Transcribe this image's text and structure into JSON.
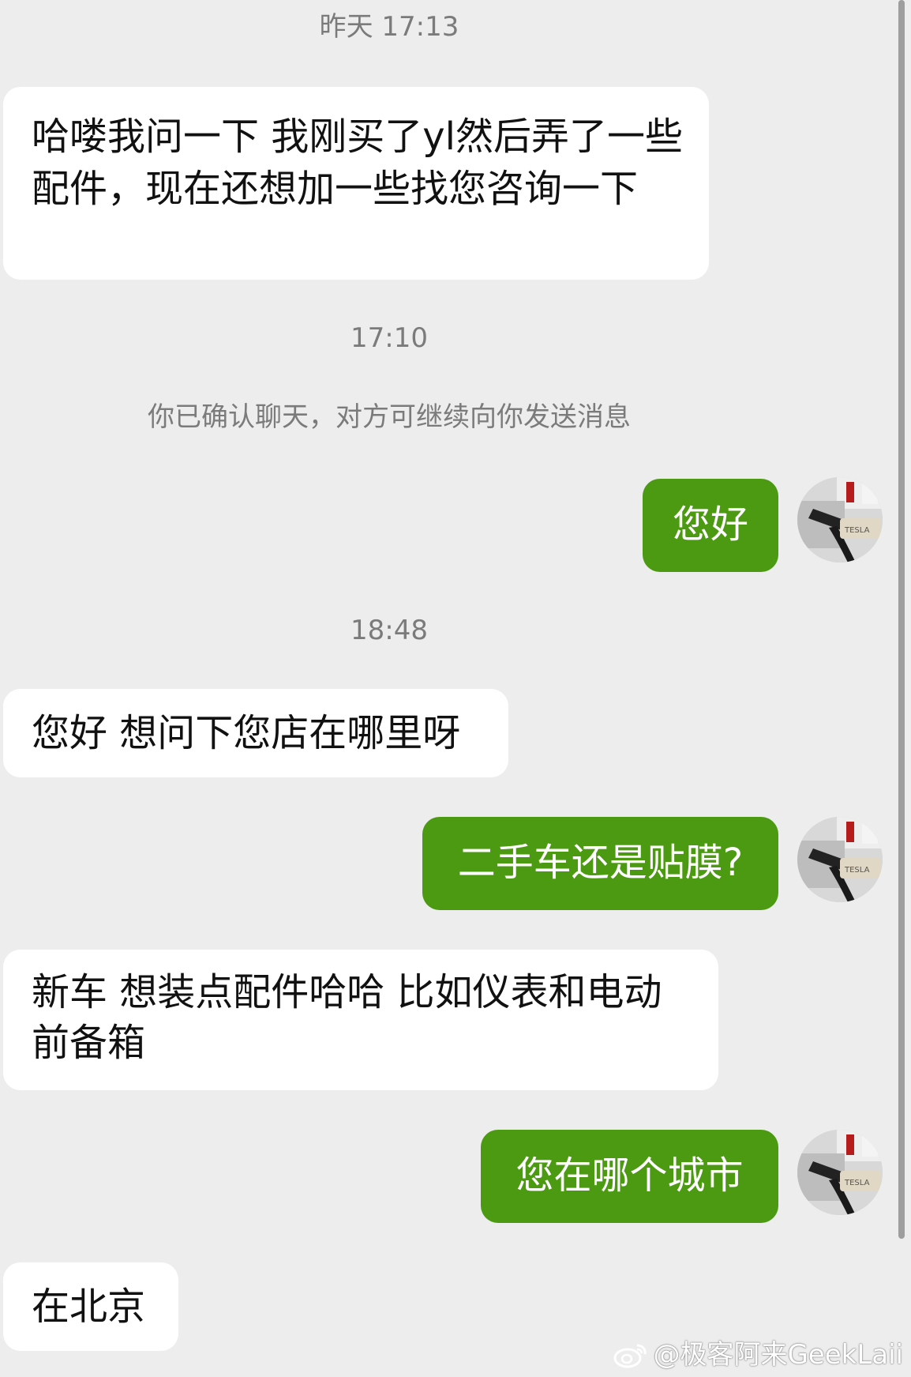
{
  "conversation": {
    "timestamp_1": "昨天 17:13",
    "msg_1": "哈喽我问一下 我刚买了yl然后弄了一些配件，现在还想加一些找您咨询一下",
    "timestamp_2": "17:10",
    "system_notice": "你已确认聊天，对方可继续向你发送消息",
    "msg_2": "您好",
    "timestamp_3": "18:48",
    "msg_3": "您好 想问下您店在哪里呀",
    "msg_4": "二手车还是贴膜?",
    "msg_5": "新车 想装点配件哈哈 比如仪表和电动前备箱",
    "msg_6": "您在哪个城市",
    "msg_7": "在北京"
  },
  "avatar": {
    "icon": "tesla-charger-avatar",
    "text": "TESLA"
  },
  "watermark": {
    "text": "@极客阿来GeekLaii",
    "icon": "weibo-icon"
  },
  "colors": {
    "outgoing_bubble": "#4c9a12",
    "incoming_bubble": "#ffffff",
    "background": "#ededed"
  }
}
